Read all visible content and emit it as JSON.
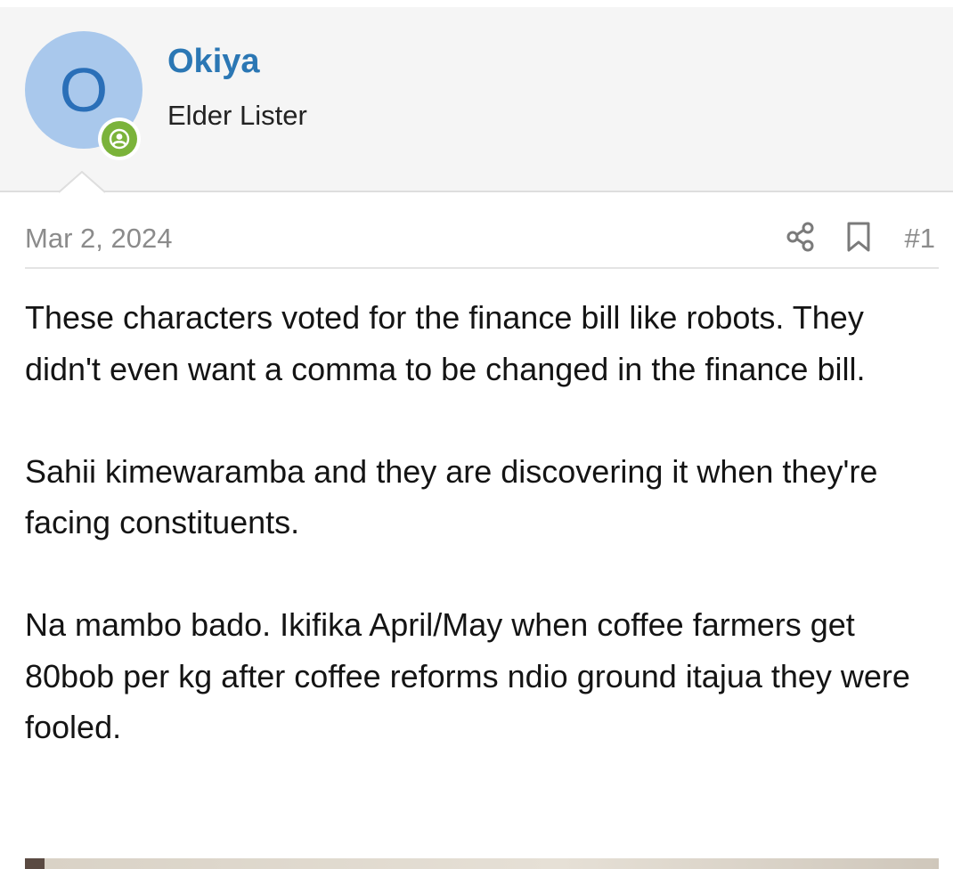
{
  "user": {
    "avatar_letter": "O",
    "name": "Okiya",
    "title": "Elder Lister",
    "status_icon": "online-user-icon",
    "avatar_color": "#a9c8ec",
    "name_color": "#2b77b4",
    "status_color": "#7bb33a"
  },
  "post": {
    "date": "Mar 2, 2024",
    "number": "#1",
    "actions": [
      "share-icon",
      "bookmark-icon"
    ],
    "paragraphs": [
      "These characters voted for the finance bill like robots. They didn't even want a comma to be changed in the finance bill.",
      "Sahii kimewaramba and they are discovering it when they're facing constituents.",
      "Na mambo bado. Ikifika April/May when coffee farmers get 80bob per kg after coffee reforms ndio ground itajua they were fooled."
    ]
  }
}
